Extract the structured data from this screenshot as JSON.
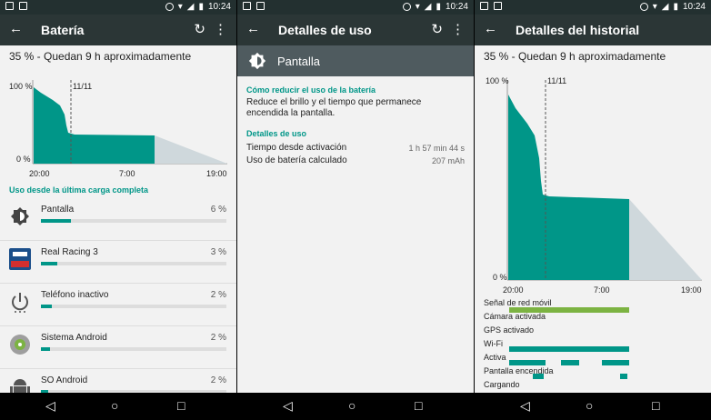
{
  "status": {
    "time": "10:24"
  },
  "battery_screen": {
    "title": "Batería",
    "summary": "35 % - Quedan 9 h aproximadamente",
    "chart": {
      "y_top": "100 %",
      "y_bottom": "0 %",
      "marker": "11/11",
      "x_ticks": [
        "20:00",
        "7:00",
        "19:00"
      ]
    },
    "section": "Uso desde la última carga completa",
    "items": [
      {
        "label": "Pantalla",
        "pct": "6 %",
        "icon": "brightness-icon",
        "value": 0.16
      },
      {
        "label": "Real Racing 3",
        "pct": "3 %",
        "icon": "real-racing-app-icon",
        "value": 0.09
      },
      {
        "label": "Teléfono inactivo",
        "pct": "2 %",
        "icon": "power-icon",
        "value": 0.06
      },
      {
        "label": "Sistema Android",
        "pct": "2 %",
        "icon": "android-system-icon",
        "value": 0.05
      },
      {
        "label": "SO Android",
        "pct": "2 %",
        "icon": "android-icon",
        "value": 0.04
      }
    ]
  },
  "usage_screen": {
    "title": "Detalles de uso",
    "header": "Pantalla",
    "reduce_title": "Cómo reducir el uso de la batería",
    "reduce_text": "Reduce el brillo y el tiempo que permanece encendida la pantalla.",
    "details_title": "Detalles de uso",
    "rows": [
      {
        "label": "Tiempo desde activación",
        "value": "1 h 57 min 44 s"
      },
      {
        "label": "Uso de batería calculado",
        "value": "207 mAh"
      }
    ]
  },
  "history_screen": {
    "title": "Detalles del historial",
    "summary": "35 % - Quedan 9 h aproximadamente",
    "chart": {
      "y_top": "100 %",
      "y_bottom": "0 %",
      "marker": "11/11",
      "x_ticks": [
        "20:00",
        "7:00",
        "19:00"
      ]
    },
    "legend": [
      "Señal de red móvil",
      "Cámara activada",
      "GPS activado",
      "Wi-Fi",
      "Activa",
      "Pantalla encendida",
      "Cargando"
    ]
  },
  "colors": {
    "accent": "#009688",
    "appbar": "#2b3636",
    "projection": "#cfd8dc"
  }
}
